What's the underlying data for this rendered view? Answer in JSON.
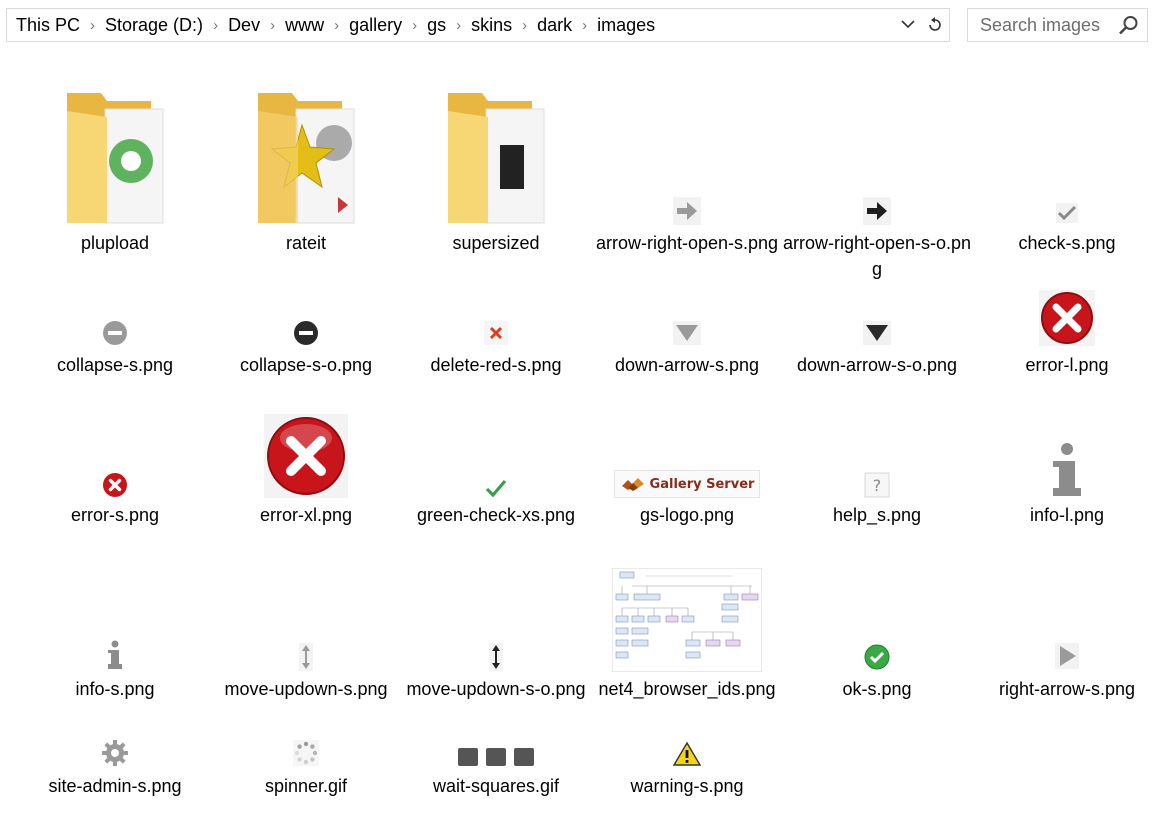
{
  "breadcrumb": [
    "This PC",
    "Storage (D:)",
    "Dev",
    "www",
    "gallery",
    "gs",
    "skins",
    "dark",
    "images"
  ],
  "search": {
    "placeholder": "Search images"
  },
  "files": [
    {
      "name": "plupload",
      "icon": "folder-green-disc-icon"
    },
    {
      "name": "rateit",
      "icon": "folder-star-icon"
    },
    {
      "name": "supersized",
      "icon": "folder-black-square-icon"
    },
    {
      "name": "arrow-right-open-s.png",
      "icon": "arrow-right-gray-icon"
    },
    {
      "name": "arrow-right-open-s-o.png",
      "icon": "arrow-right-black-icon"
    },
    {
      "name": "check-s.png",
      "icon": "check-gray-icon"
    },
    {
      "name": "collapse-s.png",
      "icon": "collapse-gray-icon"
    },
    {
      "name": "collapse-s-o.png",
      "icon": "collapse-black-icon"
    },
    {
      "name": "delete-red-s.png",
      "icon": "delete-red-icon"
    },
    {
      "name": "down-arrow-s.png",
      "icon": "down-arrow-gray-icon"
    },
    {
      "name": "down-arrow-s-o.png",
      "icon": "down-arrow-black-icon"
    },
    {
      "name": "error-l.png",
      "icon": "error-large-icon"
    },
    {
      "name": "error-s.png",
      "icon": "error-small-icon"
    },
    {
      "name": "error-xl.png",
      "icon": "error-xl-icon"
    },
    {
      "name": "green-check-xs.png",
      "icon": "green-check-icon"
    },
    {
      "name": "gs-logo.png",
      "icon": "gallery-server-logo-icon",
      "logo_text": "Gallery Server"
    },
    {
      "name": "help_s.png",
      "icon": "help-icon"
    },
    {
      "name": "info-l.png",
      "icon": "info-large-icon"
    },
    {
      "name": "info-s.png",
      "icon": "info-small-icon"
    },
    {
      "name": "move-updown-s.png",
      "icon": "move-updown-gray-icon"
    },
    {
      "name": "move-updown-s-o.png",
      "icon": "move-updown-black-icon"
    },
    {
      "name": "net4_browser_ids.png",
      "icon": "diagram-thumbnail-icon"
    },
    {
      "name": "ok-s.png",
      "icon": "ok-green-icon"
    },
    {
      "name": "right-arrow-s.png",
      "icon": "right-arrow-gray-icon"
    },
    {
      "name": "site-admin-s.png",
      "icon": "gear-icon"
    },
    {
      "name": "spinner.gif",
      "icon": "spinner-icon"
    },
    {
      "name": "wait-squares.gif",
      "icon": "wait-squares-icon"
    },
    {
      "name": "warning-s.png",
      "icon": "warning-icon"
    }
  ],
  "colors": {
    "folder": "#f7d674",
    "error_red": "#c8151b",
    "ok_green": "#3aa845",
    "addr_border": "#d9d9d9"
  }
}
